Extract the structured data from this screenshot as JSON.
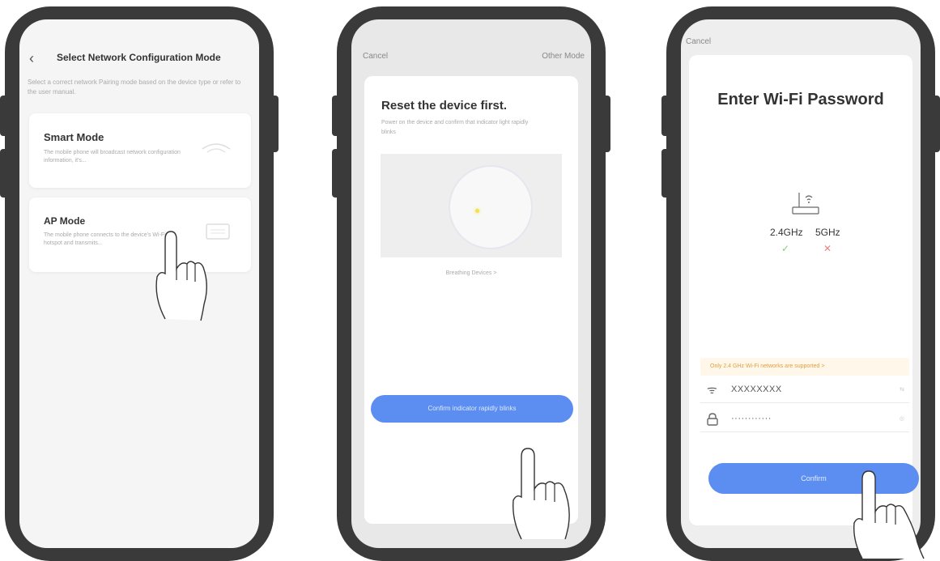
{
  "screen1": {
    "title": "Select Network Configuration Mode",
    "description": "Select a correct network Pairing mode based on the device type or refer to the user manual.",
    "smart_mode": {
      "title": "Smart Mode",
      "description": "The mobile phone will broadcast network configuration information, it's..."
    },
    "ap_mode": {
      "title": "AP Mode",
      "description": "The mobile phone connects to the device's Wi-Fi hotspot and transmits..."
    }
  },
  "screen2": {
    "cancel": "Cancel",
    "other_mode": "Other Mode",
    "title": "Reset the device first.",
    "description": "Power on the device and confirm that indicator light rapidly blinks",
    "breathing_link": "Breathing Devices >",
    "confirm_button": "Confirm indicator rapidly blinks"
  },
  "screen3": {
    "cancel": "Cancel",
    "title": "Enter Wi-Fi Password",
    "band_24": "2.4GHz",
    "band_5": "5GHz",
    "band_24_supported": "✓",
    "band_5_supported": "✕",
    "warning": "Only 2.4 GHz Wi-Fi networks are supported >",
    "ssid_value": "XXXXXXXX",
    "ssid_tail": "⇆",
    "password_value": "············",
    "password_tail": "◎",
    "confirm_button": "Confirm"
  },
  "icons": {
    "back": "‹",
    "wifi": "ᯤ",
    "lock": "🔒"
  },
  "colors": {
    "accent": "#5b8ef0",
    "phone_frame": "#3a3a3a",
    "warning": "#e0a040",
    "check": "#7fd07a",
    "cross": "#f08080"
  }
}
